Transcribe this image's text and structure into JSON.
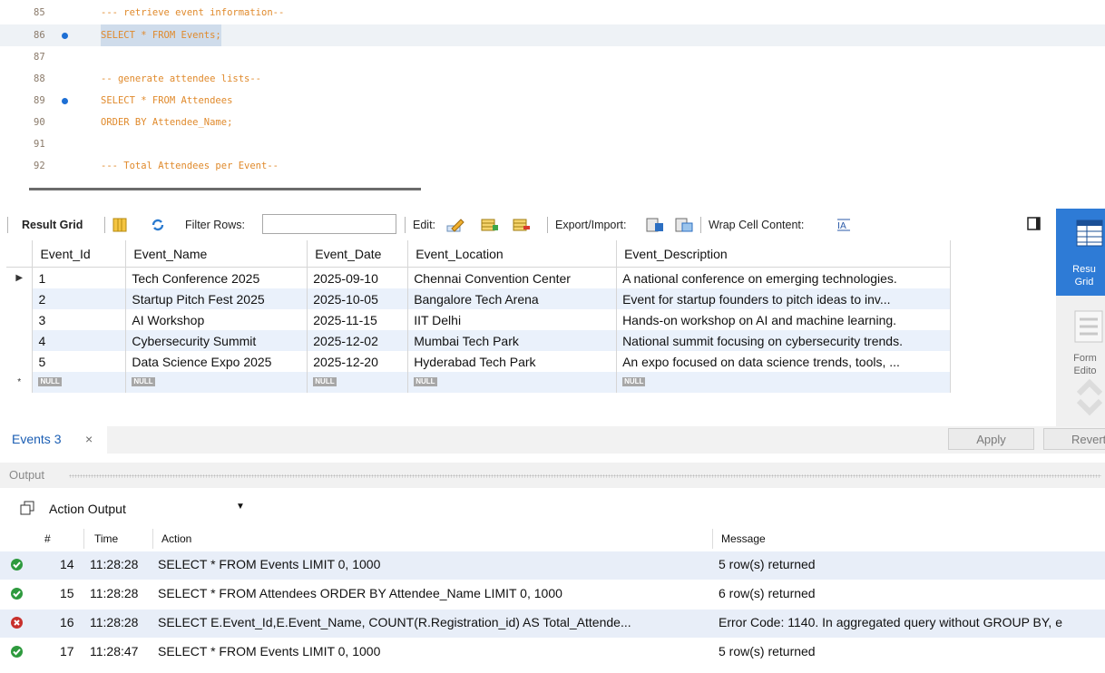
{
  "editor": {
    "lines": [
      {
        "num": "85",
        "text": "--- retrieve event information--",
        "dot": false
      },
      {
        "num": "86",
        "text": "SELECT * FROM Events;",
        "dot": true
      },
      {
        "num": "87",
        "text": "",
        "dot": false
      },
      {
        "num": "88",
        "text": "-- generate attendee lists--",
        "dot": false
      },
      {
        "num": "89",
        "text": "SELECT * FROM Attendees",
        "dot": true
      },
      {
        "num": "90",
        "text": "ORDER BY Attendee_Name;",
        "dot": false
      },
      {
        "num": "91",
        "text": "",
        "dot": false
      },
      {
        "num": "92",
        "text": "--- Total Attendees per Event--",
        "dot": false
      }
    ]
  },
  "toolbar": {
    "result_grid": "Result Grid",
    "filter_rows": "Filter Rows:",
    "edit": "Edit:",
    "export_import": "Export/Import:",
    "wrap": "Wrap Cell Content:"
  },
  "grid": {
    "columns": [
      "Event_Id",
      "Event_Name",
      "Event_Date",
      "Event_Location",
      "Event_Description"
    ],
    "rows": [
      [
        "1",
        "Tech Conference 2025",
        "2025-09-10",
        "Chennai Convention Center",
        "A national conference on emerging technologies."
      ],
      [
        "2",
        "Startup Pitch Fest 2025",
        "2025-10-05",
        "Bangalore Tech Arena",
        "Event for startup founders to pitch ideas to inv..."
      ],
      [
        "3",
        "AI Workshop",
        "2025-11-15",
        "IIT Delhi",
        "Hands-on workshop on AI and machine learning."
      ],
      [
        "4",
        "Cybersecurity Summit",
        "2025-12-02",
        "Mumbai Tech Park",
        "National summit focusing on cybersecurity trends."
      ],
      [
        "5",
        "Data Science Expo 2025",
        "2025-12-20",
        "Hyderabad Tech Park",
        "An expo focused on data science trends, tools, ..."
      ]
    ],
    "null_label": "NULL",
    "new_row_marker": "*"
  },
  "side_panel": {
    "result_grid": "Resu Grid",
    "form_editor": "Form Edito"
  },
  "tabs": {
    "active_tab": "Events 3",
    "close": "×",
    "apply": "Apply",
    "revert": "Revert"
  },
  "output": {
    "title": "Output",
    "selector": "Action Output",
    "columns": [
      "#",
      "Time",
      "Action",
      "Message"
    ],
    "rows": [
      {
        "status": "ok",
        "num": "14",
        "time": "11:28:28",
        "action": "SELECT * FROM Events LIMIT 0, 1000",
        "message": "5 row(s) returned"
      },
      {
        "status": "ok",
        "num": "15",
        "time": "11:28:28",
        "action": "SELECT * FROM Attendees ORDER BY Attendee_Name LIMIT 0, 1000",
        "message": "6 row(s) returned"
      },
      {
        "status": "error",
        "num": "16",
        "time": "11:28:28",
        "action": "SELECT E.Event_Id,E.Event_Name, COUNT(R.Registration_id) AS Total_Attende...",
        "message": "Error Code: 1140. In aggregated query without GROUP BY, e"
      },
      {
        "status": "ok",
        "num": "17",
        "time": "11:28:47",
        "action": "SELECT * FROM Events LIMIT 0, 1000",
        "message": "5 row(s) returned"
      }
    ]
  },
  "colors": {
    "accent": "#2e7bd6",
    "code": "#e08a2c",
    "ok": "#2e9a3e",
    "error": "#c8302c"
  }
}
